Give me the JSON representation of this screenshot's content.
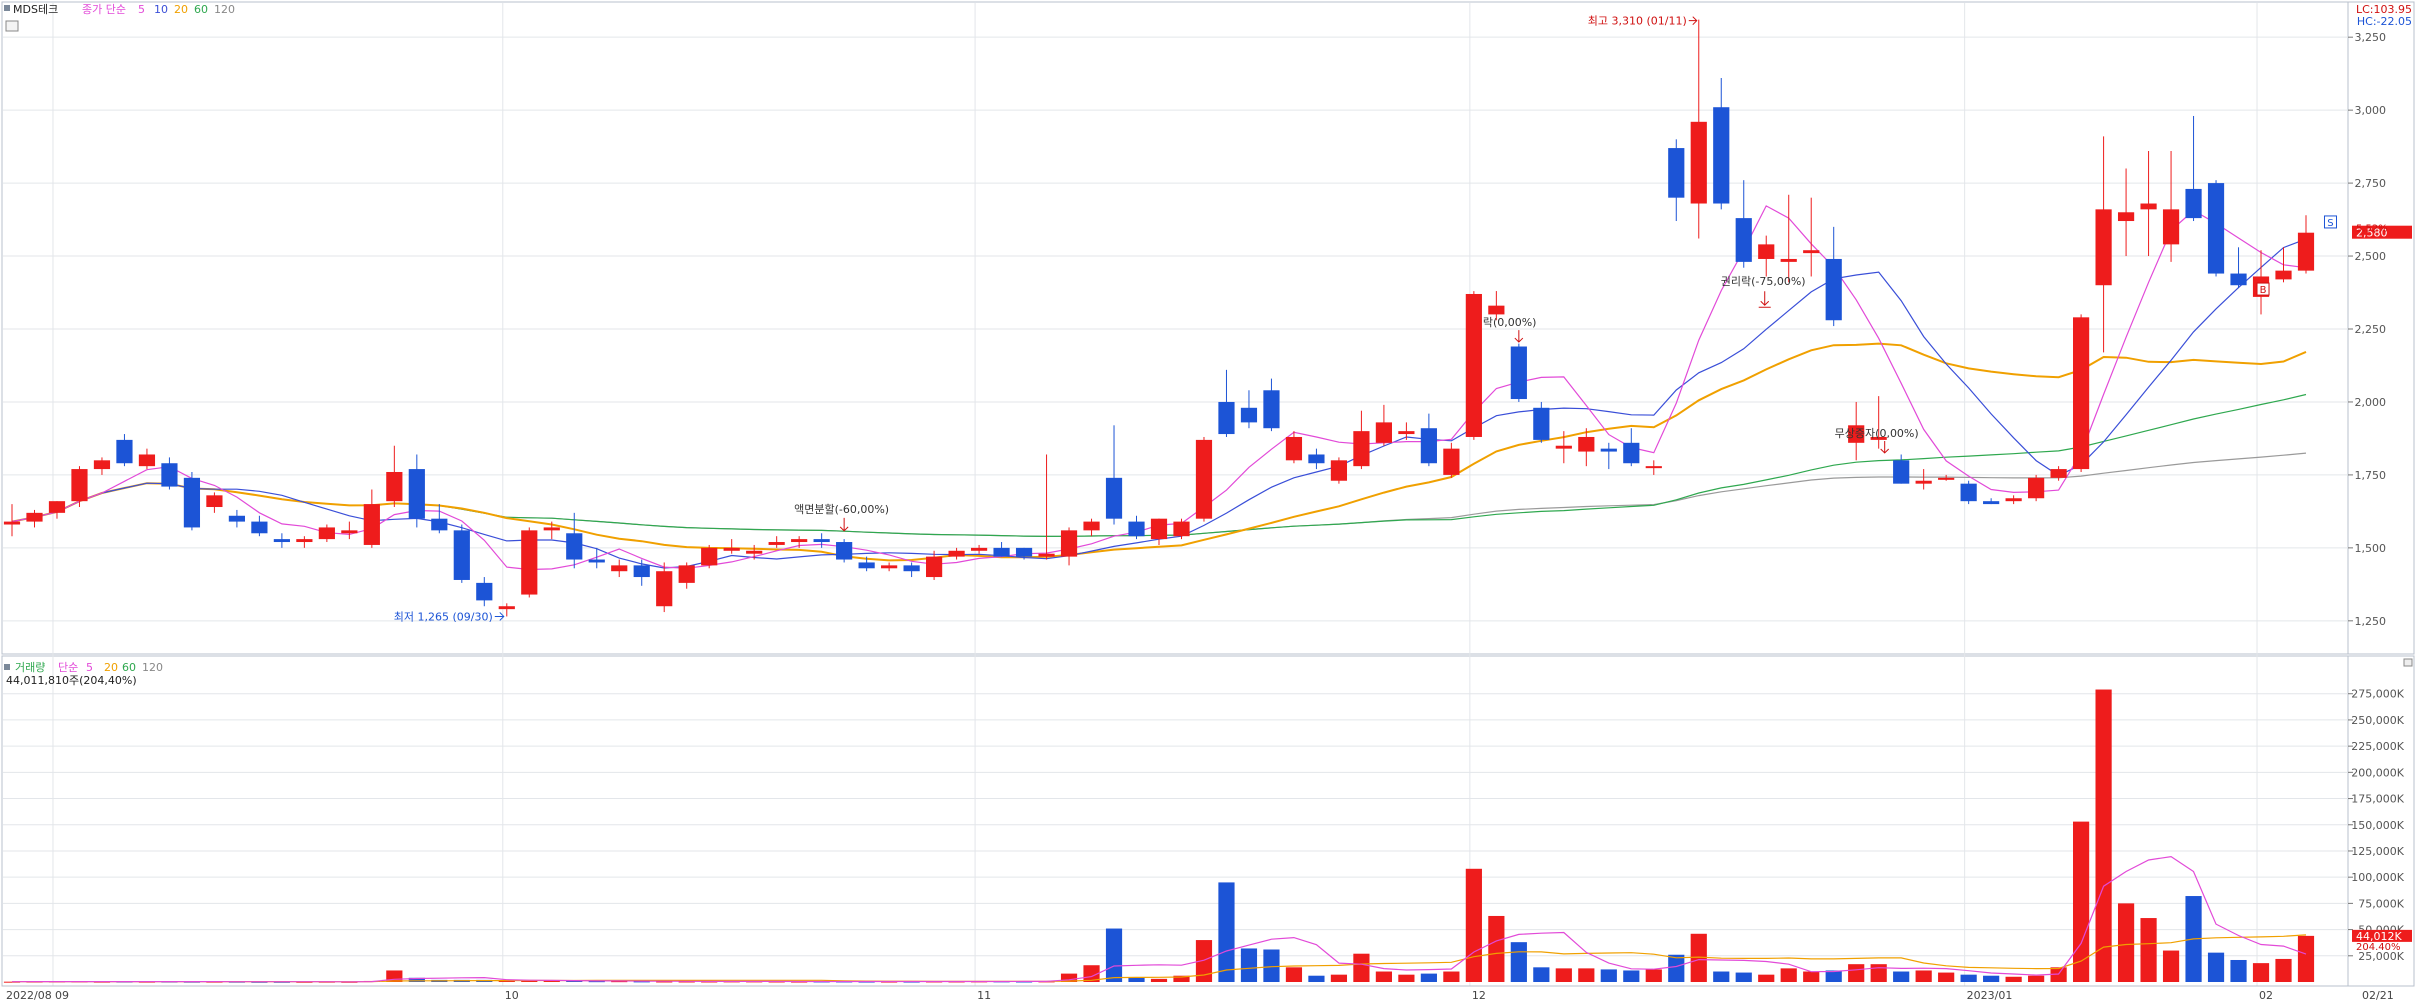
{
  "header": {
    "stock_name": "MDS테크",
    "price_ma_label": "종가 단순",
    "price_ma_periods": [
      "5",
      "10",
      "20",
      "60",
      "120"
    ],
    "volume_label": "거래량",
    "volume_ma_label": "단순",
    "volume_ma_periods": [
      "5",
      "20",
      "60",
      "120"
    ],
    "volume_readout": "44,011,810주(204,40%)",
    "lc_readout": "LC:103.95",
    "hc_readout": "HC:-22.05"
  },
  "colors": {
    "up": "#ee1c1c",
    "down": "#1c54d6",
    "ma5": "#e24ad8",
    "ma10": "#3a4fd8",
    "ma20": "#f0a000",
    "ma60": "#2fa84f",
    "ma120": "#9a9a9a"
  },
  "chart_data": [
    {
      "type": "candlestick",
      "title": "MDS테크",
      "x_labels": [
        "2022/08",
        "09",
        "10",
        "11",
        "12",
        "2023/01",
        "02",
        "02/21"
      ],
      "y_ticks": [
        "1,250",
        "1,500",
        "1,750",
        "2,000",
        "2,250",
        "2,500",
        "2,750",
        "3,000",
        "3,250"
      ],
      "ylim": [
        1150,
        3350
      ],
      "current_price": "2,580",
      "current_change": "5.52%",
      "candles": [
        {
          "o": 1580,
          "h": 1650,
          "l": 1540,
          "c": 1590
        },
        {
          "o": 1590,
          "h": 1630,
          "l": 1570,
          "c": 1620
        },
        {
          "o": 1620,
          "h": 1660,
          "l": 1600,
          "c": 1660
        },
        {
          "o": 1660,
          "h": 1780,
          "l": 1640,
          "c": 1770
        },
        {
          "o": 1770,
          "h": 1810,
          "l": 1750,
          "c": 1800
        },
        {
          "o": 1870,
          "h": 1890,
          "l": 1780,
          "c": 1790
        },
        {
          "o": 1780,
          "h": 1840,
          "l": 1770,
          "c": 1820
        },
        {
          "o": 1790,
          "h": 1810,
          "l": 1700,
          "c": 1710
        },
        {
          "o": 1740,
          "h": 1760,
          "l": 1560,
          "c": 1570
        },
        {
          "o": 1640,
          "h": 1690,
          "l": 1620,
          "c": 1680
        },
        {
          "o": 1610,
          "h": 1630,
          "l": 1570,
          "c": 1590
        },
        {
          "o": 1590,
          "h": 1610,
          "l": 1540,
          "c": 1550
        },
        {
          "o": 1530,
          "h": 1550,
          "l": 1500,
          "c": 1520
        },
        {
          "o": 1520,
          "h": 1540,
          "l": 1500,
          "c": 1530
        },
        {
          "o": 1530,
          "h": 1580,
          "l": 1520,
          "c": 1570
        },
        {
          "o": 1550,
          "h": 1590,
          "l": 1530,
          "c": 1560
        },
        {
          "o": 1510,
          "h": 1700,
          "l": 1500,
          "c": 1650
        },
        {
          "o": 1660,
          "h": 1850,
          "l": 1640,
          "c": 1760
        },
        {
          "o": 1770,
          "h": 1820,
          "l": 1570,
          "c": 1600
        },
        {
          "o": 1600,
          "h": 1650,
          "l": 1550,
          "c": 1560
        },
        {
          "o": 1560,
          "h": 1580,
          "l": 1380,
          "c": 1390
        },
        {
          "o": 1380,
          "h": 1400,
          "l": 1300,
          "c": 1320
        },
        {
          "o": 1290,
          "h": 1310,
          "l": 1265,
          "c": 1300
        },
        {
          "o": 1340,
          "h": 1570,
          "l": 1330,
          "c": 1560
        },
        {
          "o": 1560,
          "h": 1590,
          "l": 1530,
          "c": 1570
        },
        {
          "o": 1550,
          "h": 1620,
          "l": 1430,
          "c": 1460
        },
        {
          "o": 1460,
          "h": 1500,
          "l": 1430,
          "c": 1450
        },
        {
          "o": 1420,
          "h": 1460,
          "l": 1400,
          "c": 1440
        },
        {
          "o": 1440,
          "h": 1460,
          "l": 1370,
          "c": 1400
        },
        {
          "o": 1300,
          "h": 1450,
          "l": 1280,
          "c": 1420
        },
        {
          "o": 1380,
          "h": 1450,
          "l": 1360,
          "c": 1440
        },
        {
          "o": 1440,
          "h": 1510,
          "l": 1430,
          "c": 1500
        },
        {
          "o": 1490,
          "h": 1530,
          "l": 1480,
          "c": 1500
        },
        {
          "o": 1480,
          "h": 1510,
          "l": 1460,
          "c": 1490
        },
        {
          "o": 1510,
          "h": 1540,
          "l": 1500,
          "c": 1520
        },
        {
          "o": 1520,
          "h": 1540,
          "l": 1500,
          "c": 1530
        },
        {
          "o": 1530,
          "h": 1550,
          "l": 1500,
          "c": 1520
        },
        {
          "o": 1520,
          "h": 1530,
          "l": 1450,
          "c": 1460
        },
        {
          "o": 1450,
          "h": 1470,
          "l": 1420,
          "c": 1430
        },
        {
          "o": 1430,
          "h": 1450,
          "l": 1420,
          "c": 1440
        },
        {
          "o": 1440,
          "h": 1450,
          "l": 1400,
          "c": 1420
        },
        {
          "o": 1400,
          "h": 1490,
          "l": 1390,
          "c": 1470
        },
        {
          "o": 1470,
          "h": 1500,
          "l": 1460,
          "c": 1490
        },
        {
          "o": 1490,
          "h": 1510,
          "l": 1480,
          "c": 1500
        },
        {
          "o": 1500,
          "h": 1520,
          "l": 1470,
          "c": 1470
        },
        {
          "o": 1500,
          "h": 1500,
          "l": 1460,
          "c": 1470
        },
        {
          "o": 1470,
          "h": 1820,
          "l": 1460,
          "c": 1480
        },
        {
          "o": 1470,
          "h": 1570,
          "l": 1440,
          "c": 1560
        },
        {
          "o": 1560,
          "h": 1600,
          "l": 1540,
          "c": 1590
        },
        {
          "o": 1740,
          "h": 1920,
          "l": 1580,
          "c": 1600
        },
        {
          "o": 1590,
          "h": 1610,
          "l": 1530,
          "c": 1540
        },
        {
          "o": 1530,
          "h": 1600,
          "l": 1510,
          "c": 1600
        },
        {
          "o": 1540,
          "h": 1600,
          "l": 1530,
          "c": 1590
        },
        {
          "o": 1600,
          "h": 1880,
          "l": 1590,
          "c": 1870
        },
        {
          "o": 2000,
          "h": 2110,
          "l": 1880,
          "c": 1890
        },
        {
          "o": 1980,
          "h": 2040,
          "l": 1910,
          "c": 1930
        },
        {
          "o": 2040,
          "h": 2080,
          "l": 1900,
          "c": 1910
        },
        {
          "o": 1800,
          "h": 1900,
          "l": 1790,
          "c": 1880
        },
        {
          "o": 1820,
          "h": 1840,
          "l": 1770,
          "c": 1790
        },
        {
          "o": 1730,
          "h": 1810,
          "l": 1720,
          "c": 1800
        },
        {
          "o": 1780,
          "h": 1970,
          "l": 1770,
          "c": 1900
        },
        {
          "o": 1860,
          "h": 1990,
          "l": 1850,
          "c": 1930
        },
        {
          "o": 1890,
          "h": 1930,
          "l": 1870,
          "c": 1900
        },
        {
          "o": 1910,
          "h": 1960,
          "l": 1780,
          "c": 1790
        },
        {
          "o": 1750,
          "h": 1860,
          "l": 1740,
          "c": 1840
        },
        {
          "o": 1880,
          "h": 2380,
          "l": 1870,
          "c": 2370
        },
        {
          "o": 2300,
          "h": 2380,
          "l": 2280,
          "c": 2330
        },
        {
          "o": 2190,
          "h": 2200,
          "l": 2000,
          "c": 2010
        },
        {
          "o": 1980,
          "h": 2000,
          "l": 1860,
          "c": 1870
        },
        {
          "o": 1840,
          "h": 1900,
          "l": 1790,
          "c": 1850
        },
        {
          "o": 1830,
          "h": 1910,
          "l": 1780,
          "c": 1880
        },
        {
          "o": 1840,
          "h": 1860,
          "l": 1770,
          "c": 1830
        },
        {
          "o": 1860,
          "h": 1910,
          "l": 1780,
          "c": 1790
        },
        {
          "o": 1780,
          "h": 1800,
          "l": 1750,
          "c": 1780
        },
        {
          "o": 2870,
          "h": 2900,
          "l": 2620,
          "c": 2700
        },
        {
          "o": 2680,
          "h": 3310,
          "l": 2560,
          "c": 2960
        },
        {
          "o": 3010,
          "h": 3110,
          "l": 2660,
          "c": 2680
        },
        {
          "o": 2630,
          "h": 2760,
          "l": 2460,
          "c": 2480
        },
        {
          "o": 2490,
          "h": 2570,
          "l": 2430,
          "c": 2540
        },
        {
          "o": 2480,
          "h": 2710,
          "l": 2410,
          "c": 2490
        },
        {
          "o": 2510,
          "h": 2700,
          "l": 2430,
          "c": 2520
        },
        {
          "o": 2490,
          "h": 2600,
          "l": 2260,
          "c": 2280
        },
        {
          "o": 1860,
          "h": 2000,
          "l": 1800,
          "c": 1920
        },
        {
          "o": 1870,
          "h": 2020,
          "l": 1840,
          "c": 1880
        },
        {
          "o": 1800,
          "h": 1820,
          "l": 1720,
          "c": 1720
        },
        {
          "o": 1720,
          "h": 1770,
          "l": 1700,
          "c": 1730
        },
        {
          "o": 1740,
          "h": 1750,
          "l": 1730,
          "c": 1740
        },
        {
          "o": 1720,
          "h": 1730,
          "l": 1650,
          "c": 1660
        },
        {
          "o": 1660,
          "h": 1670,
          "l": 1650,
          "c": 1650
        },
        {
          "o": 1660,
          "h": 1680,
          "l": 1650,
          "c": 1670
        },
        {
          "o": 1670,
          "h": 1750,
          "l": 1660,
          "c": 1740
        },
        {
          "o": 1740,
          "h": 1780,
          "l": 1730,
          "c": 1770
        },
        {
          "o": 1770,
          "h": 2300,
          "l": 1760,
          "c": 2290
        },
        {
          "o": 2400,
          "h": 2910,
          "l": 2170,
          "c": 2660
        },
        {
          "o": 2620,
          "h": 2800,
          "l": 2500,
          "c": 2650
        },
        {
          "o": 2660,
          "h": 2860,
          "l": 2500,
          "c": 2680
        },
        {
          "o": 2540,
          "h": 2860,
          "l": 2480,
          "c": 2660
        },
        {
          "o": 2730,
          "h": 2980,
          "l": 2620,
          "c": 2630
        },
        {
          "o": 2750,
          "h": 2760,
          "l": 2430,
          "c": 2440
        },
        {
          "o": 2440,
          "h": 2530,
          "l": 2390,
          "c": 2400
        },
        {
          "o": 2360,
          "h": 2520,
          "l": 2300,
          "c": 2430
        },
        {
          "o": 2420,
          "h": 2530,
          "l": 2410,
          "c": 2450
        },
        {
          "o": 2450,
          "h": 2640,
          "l": 2440,
          "c": 2580
        }
      ],
      "volume": [
        0.3,
        0.4,
        0.5,
        0.5,
        0.3,
        0.4,
        0.3,
        0.4,
        0.3,
        0.3,
        0.3,
        0.2,
        0.2,
        0.2,
        0.3,
        0.2,
        1.0,
        11.0,
        4.0,
        2.0,
        2.0,
        2.0,
        1.0,
        1.5,
        1.0,
        1.0,
        0.8,
        0.8,
        0.6,
        0.5,
        0.5,
        0.5,
        0.6,
        0.6,
        0.5,
        0.4,
        0.5,
        0.5,
        0.4,
        0.4,
        0.4,
        0.5,
        0.5,
        0.6,
        0.6,
        0.5,
        0.6,
        8.0,
        16.0,
        51.0,
        4.0,
        3.0,
        6.0,
        40.0,
        95.0,
        32.0,
        31.0,
        14.0,
        6.0,
        7.0,
        27.0,
        10.0,
        7.0,
        8.0,
        10.0,
        108.0,
        63.0,
        38.0,
        14.0,
        13.0,
        13.0,
        12.0,
        11.0,
        12.0,
        26.0,
        46.0,
        10.0,
        9.0,
        7.0,
        13.0,
        10.0,
        11.0,
        17.0,
        17.0,
        10.0,
        11.0,
        9.0,
        7.0,
        6.0,
        5.0,
        6.0,
        14.0,
        153.0,
        279.0,
        75.0,
        61.0,
        30.0,
        82.0,
        28.0,
        21.0,
        18.0,
        22.0,
        44.0
      ],
      "volume_ticks": [
        "25,000K",
        "50,000K",
        "75,000K",
        "100,000K",
        "125,000K",
        "150,000K",
        "175,000K",
        "200,000K",
        "225,000K",
        "250,000K",
        "275,000K"
      ],
      "current_volume": "44,012K",
      "current_volume_pct": "204.40%",
      "annotations": {
        "high": "최고 3,310 (01/11)",
        "low": "최저 1,265 (09/30)",
        "split": "액면분할(-60,00%)",
        "rights1": "권리락(-75,00%)",
        "rights2": "락(0,00%)",
        "bonus": "무상증자(0,00%)",
        "marker_b": "B",
        "marker_s": "S"
      }
    }
  ]
}
